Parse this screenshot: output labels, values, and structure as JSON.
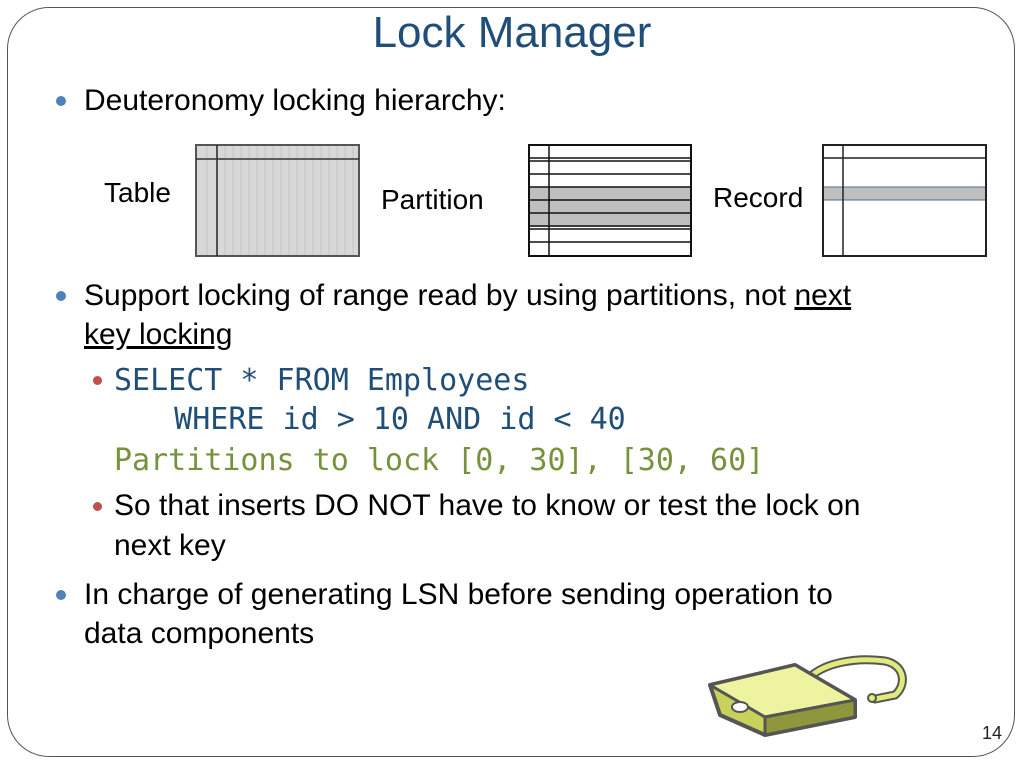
{
  "slide": {
    "title": "Lock Manager",
    "page_number": "14"
  },
  "bullets": [
    {
      "text": "Deuteronomy locking hierarchy:"
    },
    {
      "text_part1": "Support locking of range read by using partitions, not ",
      "underlined_part": "next",
      "line2_underlined": "key locking"
    },
    {
      "text_line1": "In charge of generating LSN before sending operation to",
      "text_line2": "data components"
    }
  ],
  "sub_bullets": {
    "code_line1": "SELECT * FROM Employees",
    "code_line2": "   WHERE id > 10 AND id < 40",
    "code_line3": "Partitions to lock [0, 30], [30, 60]",
    "text_line1": "So that inserts DO NOT have to know or test the lock on",
    "text_line2": "next key"
  },
  "diagram": {
    "labels": {
      "table": "Table",
      "partition": "Partition",
      "record": "Record"
    }
  },
  "colors": {
    "title": "#1f4e79",
    "bullet_level1": "#4f81bd",
    "bullet_level2": "#c0504d",
    "code_query": "#1f4e79",
    "code_partitions": "#76923c"
  }
}
